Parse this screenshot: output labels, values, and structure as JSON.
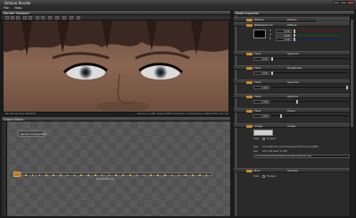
{
  "window": {
    "title": "Octane Render"
  },
  "menu": [
    "File",
    "Help"
  ],
  "viewport": {
    "title": "Render Viewport",
    "status_left": "Rendering done. 00:00:00",
    "status_right": "Device: 1 | GPU: Quadro 4000 | 00:00:00 | 100 samples | 1920x1080 | 44.3 fps"
  },
  "graph_editor": {
    "title": "Graph Editor",
    "render_config_node": "Render Configuration",
    "mesh_label": "PhighestD.obj"
  },
  "inspector": {
    "title": "Node Inspector",
    "diffuse": {
      "label": "Diffuse",
      "label2": "Diffuse"
    },
    "rgb": {
      "label": "RGBspectrum",
      "value_label": "Diffuse",
      "r": "0.000",
      "g": "0.000",
      "b": "0.000"
    },
    "sections": [
      {
        "label": "Float",
        "label2": "Specular",
        "value": "0.000"
      },
      {
        "label": "Float",
        "label2": "Roughness",
        "value": "0.000"
      },
      {
        "label": "Float",
        "label2": "Specular",
        "value": "1.000"
      },
      {
        "label": "Float",
        "label2": "Gamma",
        "value": "2.200"
      },
      {
        "label": "Float",
        "label2": "Power",
        "value": "1.000"
      }
    ],
    "image": {
      "label": "Image",
      "label2": "Image",
      "state_label": "State",
      "state_value": "Enabled",
      "type_label": "Type",
      "type_value": "24 bit RGB LDR | Joint Photographic Experts Group (JPEG)",
      "size_label": "Size",
      "size_value": "256 x 256 pixels | 0.2 MB",
      "path": "C:/Users/Documents/Desktop/Textures/Sphere/Ubyte512.jpg"
    },
    "bool": {
      "label": "Bool",
      "label2": "Smooth",
      "state_label": "State",
      "state_value": "Enabled"
    }
  }
}
